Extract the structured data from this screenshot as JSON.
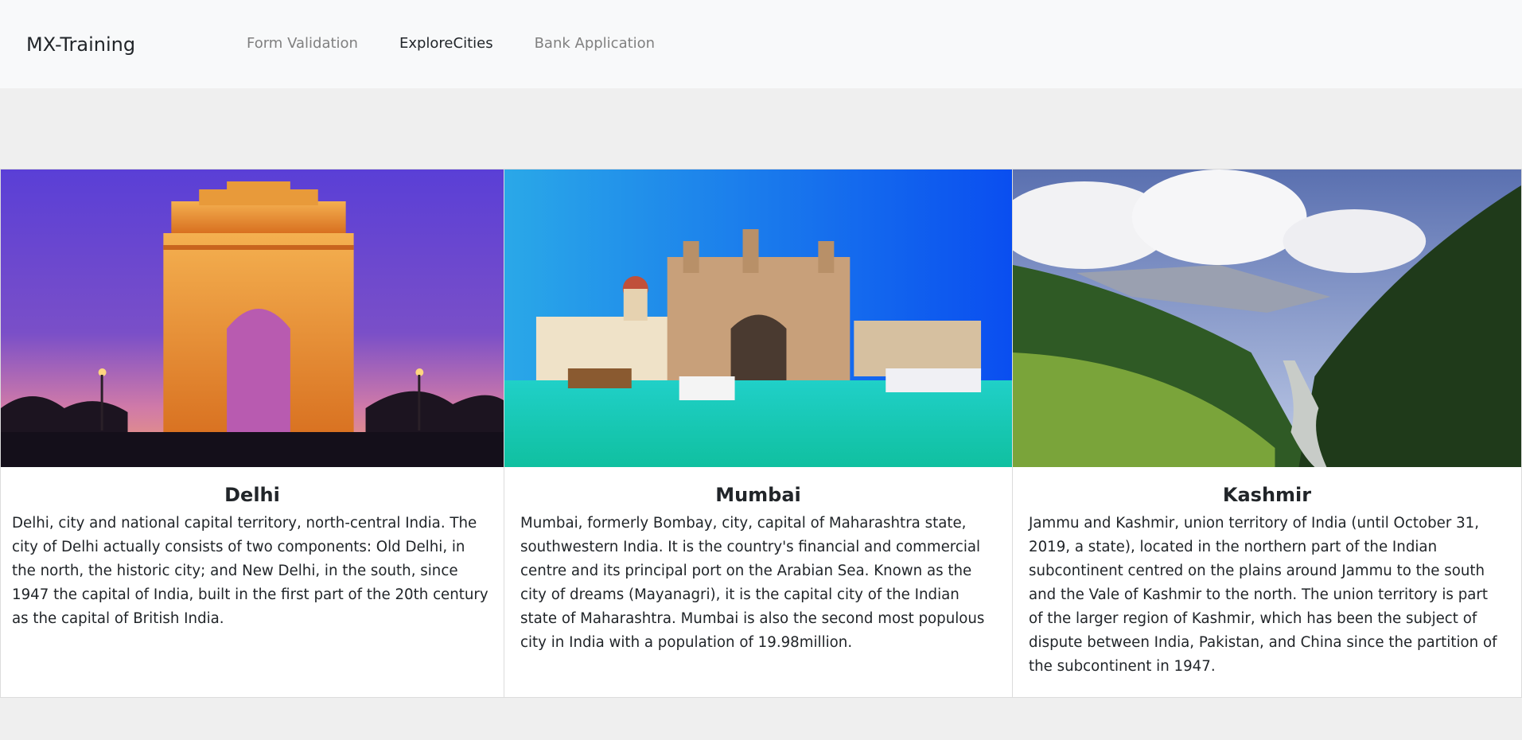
{
  "navbar": {
    "brand": "MX-Training",
    "links": [
      {
        "label": "Form Validation",
        "active": false
      },
      {
        "label": "ExploreCities",
        "active": true
      },
      {
        "label": "Bank Application",
        "active": false
      }
    ]
  },
  "cities": [
    {
      "name": "Delhi",
      "description": "Delhi, city and national capital territory, north-central India. The city of Delhi actually consists of two components: Old Delhi, in the north, the historic city; and New Delhi, in the south, since 1947 the capital of India, built in the first part of the 20th century as the capital of British India."
    },
    {
      "name": "Mumbai",
      "description": "Mumbai, formerly Bombay, city, capital of Maharashtra state, southwestern India. It is the country's financial and commercial centre and its principal port on the Arabian Sea. Known as the city of dreams (Mayanagri), it is the capital city of the Indian state of Maharashtra. Mumbai is also the second most populous city in India with a population of 19.98million."
    },
    {
      "name": "Kashmir",
      "description": "Jammu and Kashmir, union territory of India (until October 31, 2019, a state), located in the northern part of the Indian subcontinent centred on the plains around Jammu to the south and the Vale of Kashmir to the north. The union territory is part of the larger region of Kashmir, which has been the subject of dispute between India, Pakistan, and China since the partition of the subcontinent in 1947."
    }
  ],
  "colors": {
    "navbar_bg": "#f8f9fa",
    "page_bg": "#efefef",
    "active_link": "#212529",
    "inactive_link": "#808080"
  }
}
